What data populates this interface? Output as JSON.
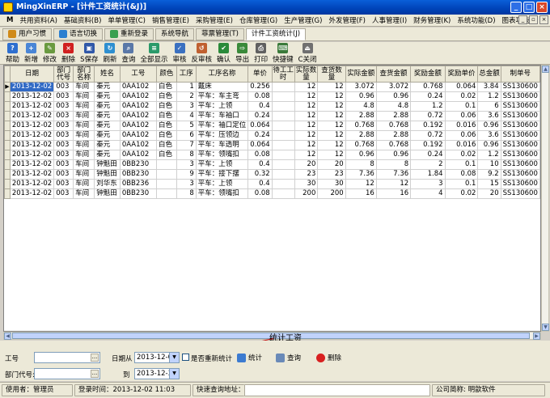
{
  "window": {
    "title": "MingXinERP - [计件工资统计(&J)]"
  },
  "menu": [
    "共用资料(A)",
    "基础资料(B)",
    "单单管理(C)",
    "销售管理(E)",
    "采购管理(E)",
    "仓库管理(G)",
    "生产管理(G)",
    "外发管理(F)",
    "人事管理(I)",
    "财务管理(K)",
    "系统功能(D)",
    "图表功能"
  ],
  "tabs": [
    {
      "label": "用户习惯",
      "color": "#d08a18"
    },
    {
      "label": "语言切换",
      "color": "#2c7fd0"
    },
    {
      "label": "重新登录",
      "color": "#3aa050"
    },
    {
      "label": "系统导航",
      "color": ""
    },
    {
      "label": "菲票管理(T)",
      "color": ""
    },
    {
      "label": "计件工资统计(J)",
      "color": ""
    }
  ],
  "toolbar": [
    {
      "label": "帮助",
      "color": "#2e6fcf",
      "glyph": "?"
    },
    {
      "label": "新增",
      "color": "#4a86d6",
      "glyph": "+"
    },
    {
      "label": "修改",
      "color": "#6a9a40",
      "glyph": "✎"
    },
    {
      "label": "删除",
      "color": "#d02020",
      "glyph": "×"
    },
    {
      "label": "S保存",
      "color": "#3058a8",
      "glyph": "▣"
    },
    {
      "label": "刷新",
      "color": "#2e8fd0",
      "glyph": "↻"
    },
    {
      "label": "查询",
      "color": "#5a78a8",
      "glyph": "⌕"
    },
    {
      "label": "全部显示",
      "color": "#2a9a6a",
      "glyph": "≡"
    },
    {
      "label": "审核",
      "color": "#3a70c0",
      "glyph": "✓"
    },
    {
      "label": "反审核",
      "color": "#c06030",
      "glyph": "↺"
    },
    {
      "label": "确认",
      "color": "#2a8a3a",
      "glyph": "✔"
    },
    {
      "label": "导出",
      "color": "#3a8a3a",
      "glyph": "⇨"
    },
    {
      "label": "打印",
      "color": "#606060",
      "glyph": "⎙"
    },
    {
      "label": "快捷键",
      "color": "#3a7a3a",
      "glyph": "⌨"
    },
    {
      "label": "C关闭",
      "color": "#707070",
      "glyph": "⏏"
    }
  ],
  "grid": {
    "headers": [
      "日期",
      "部门代号",
      "部门名称",
      "姓名",
      "工号",
      "颜色",
      "工序",
      "工序名称",
      "单价",
      "待工工时",
      "实际数量",
      "查货数量",
      "实际金额",
      "查货金额",
      "奖励金额",
      "奖励单价",
      "总金额",
      "制单号"
    ],
    "rows": [
      [
        "2013-12-02",
        "003",
        "车间",
        "秦元",
        "0AA102",
        "白色",
        "1",
        "戴床",
        "0.256",
        "",
        "12",
        "12",
        "3.072",
        "3.072",
        "0.768",
        "0.064",
        "3.84",
        "SS130600"
      ],
      [
        "2013-12-02",
        "003",
        "车间",
        "秦元",
        "0AA102",
        "白色",
        "2",
        "平车：车主弯",
        "0.08",
        "",
        "12",
        "12",
        "0.96",
        "0.96",
        "0.24",
        "0.02",
        "1.2",
        "SS130600"
      ],
      [
        "2013-12-02",
        "003",
        "车间",
        "秦元",
        "0AA102",
        "白色",
        "3",
        "平车：上领",
        "0.4",
        "",
        "12",
        "12",
        "4.8",
        "4.8",
        "1.2",
        "0.1",
        "6",
        "SS130600"
      ],
      [
        "2013-12-02",
        "003",
        "车间",
        "秦元",
        "0AA102",
        "白色",
        "4",
        "平车：车袖口",
        "0.24",
        "",
        "12",
        "12",
        "2.88",
        "2.88",
        "0.72",
        "0.06",
        "3.6",
        "SS130600"
      ],
      [
        "2013-12-02",
        "003",
        "车间",
        "秦元",
        "0AA102",
        "白色",
        "5",
        "平车：袖口定位",
        "0.064",
        "",
        "12",
        "12",
        "0.768",
        "0.768",
        "0.192",
        "0.016",
        "0.96",
        "SS130600"
      ],
      [
        "2013-12-02",
        "003",
        "车间",
        "秦元",
        "0AA102",
        "白色",
        "6",
        "平车：压领边",
        "0.24",
        "",
        "12",
        "12",
        "2.88",
        "2.88",
        "0.72",
        "0.06",
        "3.6",
        "SS130600"
      ],
      [
        "2013-12-02",
        "003",
        "车间",
        "秦元",
        "0AA102",
        "白色",
        "7",
        "平车：车透明",
        "0.064",
        "",
        "12",
        "12",
        "0.768",
        "0.768",
        "0.192",
        "0.016",
        "0.96",
        "SS130600"
      ],
      [
        "2013-12-02",
        "003",
        "车间",
        "秦元",
        "0AA102",
        "白色",
        "8",
        "平车：领嘴扣",
        "0.08",
        "",
        "12",
        "12",
        "0.96",
        "0.96",
        "0.24",
        "0.02",
        "1.2",
        "SS130600"
      ],
      [
        "2013-12-02",
        "003",
        "车间",
        "钟魁田",
        "0BB230",
        "",
        "3",
        "平车：上领",
        "0.4",
        "",
        "20",
        "20",
        "8",
        "8",
        "2",
        "0.1",
        "10",
        "SS130600"
      ],
      [
        "2013-12-02",
        "003",
        "车间",
        "钟魁田",
        "0BB230",
        "",
        "9",
        "平车：接下摆",
        "0.32",
        "",
        "23",
        "23",
        "7.36",
        "7.36",
        "1.84",
        "0.08",
        "9.2",
        "SS130600"
      ],
      [
        "2013-12-02",
        "003",
        "车间",
        "刘华东",
        "0BB236",
        "",
        "3",
        "平车：上领",
        "0.4",
        "",
        "30",
        "30",
        "12",
        "12",
        "3",
        "0.1",
        "15",
        "SS130600"
      ],
      [
        "2013-12-02",
        "003",
        "车间",
        "钟魁田",
        "0BB230",
        "",
        "8",
        "平车：领嘴扣",
        "0.08",
        "",
        "200",
        "200",
        "16",
        "16",
        "4",
        "0.02",
        "20",
        "SS130600"
      ]
    ]
  },
  "annotation": "统计工资",
  "filter": {
    "worker_label": "工号",
    "dept_label": "部门代号:",
    "date_from_label": "日期从",
    "date_to_label": "到",
    "date_from": "2013-12-01",
    "date_to": "2013-12-31",
    "recount_label": "是否重新统计",
    "stat_button": "统计",
    "query_button": "查询",
    "delete_button": "删除"
  },
  "status": {
    "user": "使用者：管理员",
    "login_time": "登录时间：2013-12-02 11:03",
    "quick_query": "快速查询地址：",
    "company": "公司简称: 明歆软件"
  }
}
